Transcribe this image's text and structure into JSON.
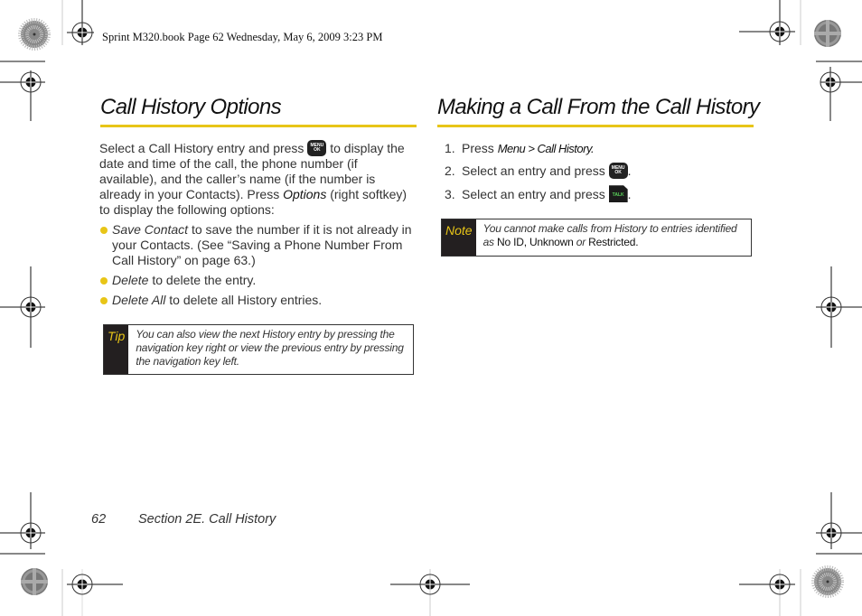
{
  "header": {
    "print_info": "Sprint M320.book  Page 62  Wednesday, May 6, 2009  3:23 PM"
  },
  "left": {
    "title": "Call History Options",
    "intro": {
      "part1": "Select a Call History entry and press",
      "part2": "to display the date and time of the call, the phone number (if available), and the caller’s name (if the number is already in your Contacts). Press",
      "options_label": "Options",
      "part3": "(right softkey) to display the following options:"
    },
    "bullets": [
      {
        "term": "Save Contact",
        "text": "to save the number if it is not already in your Contacts. (See “Saving a Phone Number From Call History” on page 63.)"
      },
      {
        "term": "Delete",
        "text": "to delete the entry."
      },
      {
        "term": "Delete All",
        "text": "to delete all History entries."
      }
    ],
    "tip": {
      "label": "Tip",
      "text": "You can also view the next History entry by pressing the navigation key right or view the previous entry by pressing the navigation key left."
    }
  },
  "right": {
    "title": "Making a Call From the Call History",
    "steps": [
      {
        "num": "1.",
        "text": "Press",
        "menu_path": "Menu > Call History."
      },
      {
        "num": "2.",
        "text": "Select an entry and press",
        "suffix": "."
      },
      {
        "num": "3.",
        "text": "Select an entry and press",
        "suffix": "."
      }
    ],
    "note": {
      "label": "Note",
      "text1": "You cannot make calls from History to entries identified as",
      "no_id": "No ID",
      "comma": ",",
      "unknown": "Unknown",
      "or": "or",
      "restricted": "Restricted",
      "period": "."
    }
  },
  "keys": {
    "menu_ok_top": "MENU",
    "menu_ok_bottom": "OK",
    "talk": "TALK"
  },
  "footer": {
    "page_number": "62",
    "section": "Section 2E. Call History"
  },
  "colors": {
    "accent_yellow": "#e8c517",
    "label_bg": "#231f20",
    "talk_green": "#5bd65b"
  }
}
